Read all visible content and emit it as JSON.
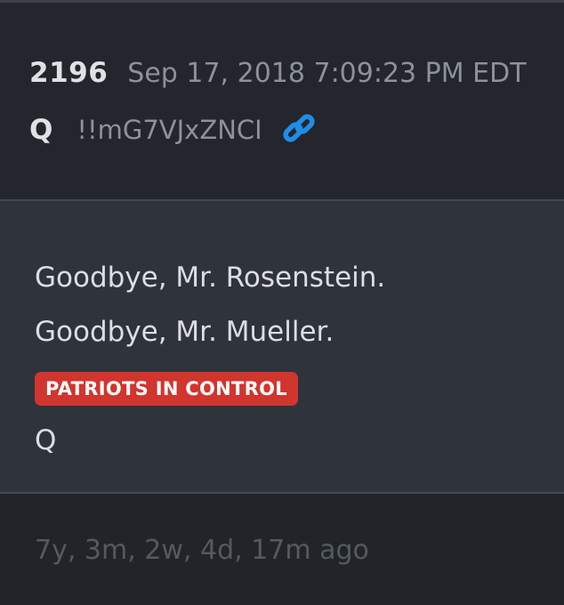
{
  "post": {
    "number": "2196",
    "date": "Sep 17, 2018 7:09:23 PM EDT",
    "author": "Q",
    "tripcode": "!!mG7VJxZNCI",
    "link_icon": "link-icon"
  },
  "body": {
    "lines": [
      "Goodbye, Mr. Rosenstein.",
      "Goodbye, Mr. Mueller."
    ],
    "badge": "PATRIOTS IN CONTROL",
    "signature": "Q"
  },
  "footer": {
    "time_ago": "7y, 3m, 2w, 4d, 17m ago"
  },
  "colors": {
    "background": "#23262c",
    "body_background": "#2f333b",
    "badge": "#d1352e",
    "link": "#1e8ee8",
    "muted_text": "#8d9198"
  }
}
